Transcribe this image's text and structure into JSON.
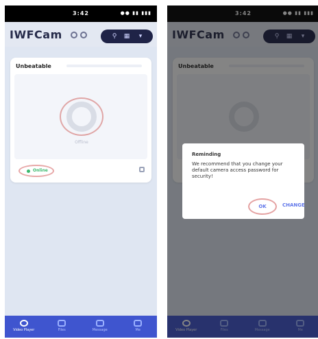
{
  "status_bar": {
    "time": "3:42",
    "icons_text": "●● ▮▮ ▮▮▮"
  },
  "app": {
    "title": "IWFCam"
  },
  "device": {
    "name": "Unbeatable",
    "status_label": "Online",
    "preview_caption": "Offline"
  },
  "dialog": {
    "title": "Reminding",
    "message": "We recommend that you change your default camera access password for security!",
    "ok_label": "OK",
    "change_label": "CHANGE"
  },
  "tabs": [
    {
      "label": "Video Player"
    },
    {
      "label": "Files"
    },
    {
      "label": "Message"
    },
    {
      "label": "Me"
    }
  ],
  "colors": {
    "accent": "#3f55cf",
    "online": "#3cb96e",
    "annotation": "#e4a1a1",
    "header_pill": "#1f2347"
  }
}
